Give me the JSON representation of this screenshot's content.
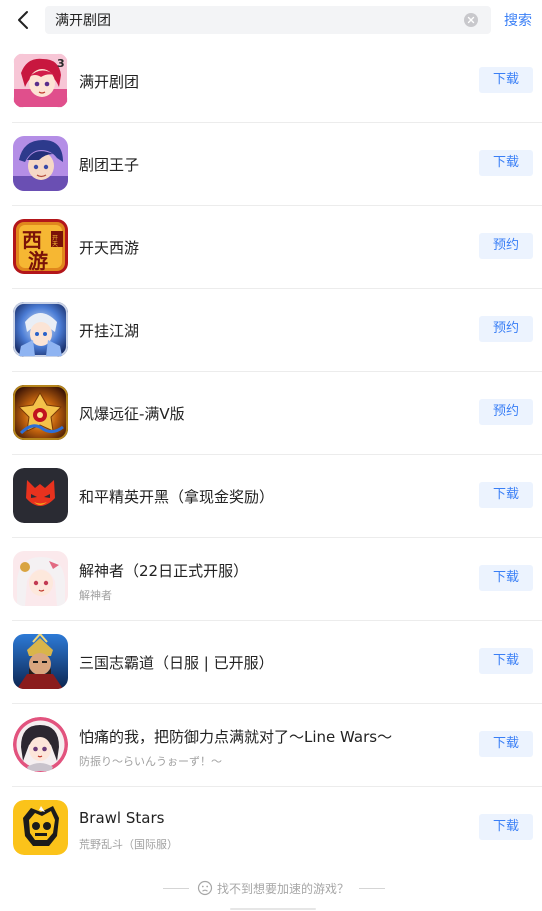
{
  "search": {
    "value": "满开剧团",
    "button_label": "搜索"
  },
  "games": [
    {
      "name": "满开剧团",
      "subtitle": "",
      "action": "下载",
      "icon": "anime-girl-pink-icon"
    },
    {
      "name": "剧团王子",
      "subtitle": "",
      "action": "下载",
      "icon": "anime-boy-purple-icon"
    },
    {
      "name": "开天西游",
      "subtitle": "",
      "action": "预约",
      "icon": "xiyou-logo-icon"
    },
    {
      "name": "开挂江湖",
      "subtitle": "",
      "action": "预约",
      "icon": "fantasy-warrior-icon"
    },
    {
      "name": "风爆远征-满V版",
      "subtitle": "",
      "action": "预约",
      "icon": "golden-emblem-icon"
    },
    {
      "name": "和平精英开黑（拿现金奖励）",
      "subtitle": "",
      "action": "下载",
      "icon": "red-face-mascot-icon"
    },
    {
      "name": "解神者（22日正式开服）",
      "subtitle": "解神者",
      "action": "下载",
      "icon": "white-hair-girl-icon"
    },
    {
      "name": "三国志霸道（日服 | 已开服）",
      "subtitle": "",
      "action": "下载",
      "icon": "three-kingdoms-warrior-icon"
    },
    {
      "name": "怕痛的我，把防御力点满就对了〜Line Wars〜",
      "subtitle": "防振り〜らいんうぉーず！〜",
      "action": "下载",
      "icon": "chibi-girl-icon"
    },
    {
      "name": "Brawl Stars",
      "subtitle": "荒野乱斗（国际服）",
      "action": "下载",
      "icon": "brawl-skull-icon"
    }
  ],
  "footer": {
    "text": "找不到想要加速的游戏？"
  },
  "colors": {
    "accent": "#3a7ff6",
    "button_bg": "#ecf3fe"
  }
}
